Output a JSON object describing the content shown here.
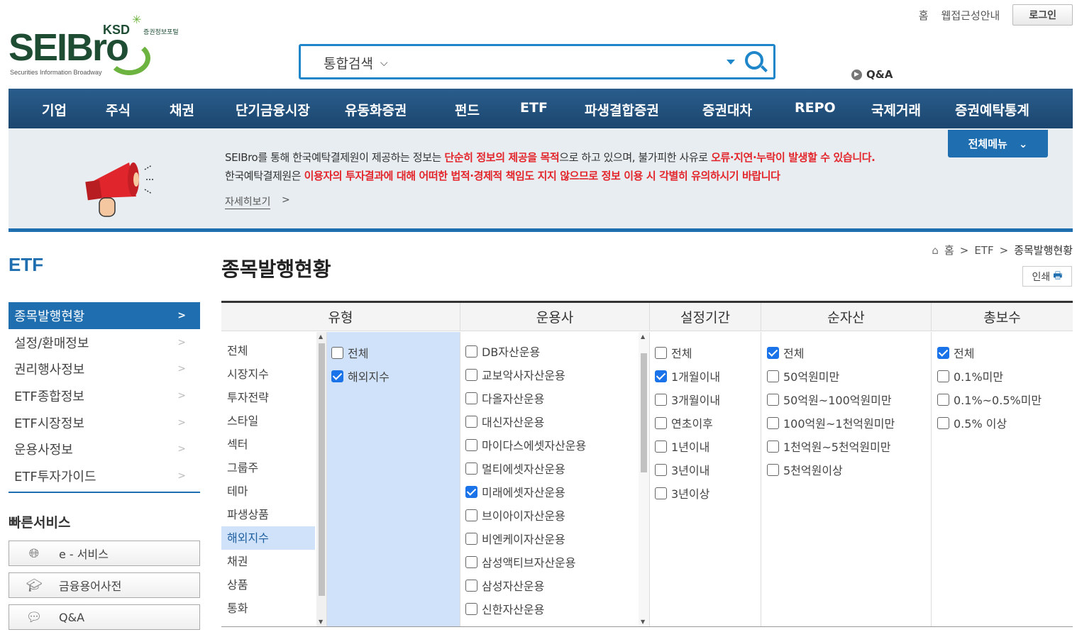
{
  "header": {
    "logo_main": "SEIBro",
    "logo_ksd": "KSD",
    "logo_portal": "증권정보포털",
    "logo_sub": "Securities Information Broadway",
    "links": [
      "홈",
      "웹접근성안내"
    ],
    "login_label": "로그인",
    "search_select": "통합검색",
    "qa_label": "Q&A"
  },
  "nav": {
    "items": [
      "기업",
      "주식",
      "채권",
      "단기금융시장",
      "유동화증권",
      "펀드",
      "ETF",
      "파생결합증권",
      "증권대차",
      "REPO",
      "국제거래",
      "증권예탁통계"
    ]
  },
  "banner": {
    "line1_a": "SEIBro를 통해 한국예탁결제원이 제공하는 정보는 ",
    "line1_b": "단순히 정보의 제공을 목적",
    "line1_c": "으로 하고 있으며, 불가피한 사유로 ",
    "line1_d": "오류·지연·누락이 발생할 수 있습니다.",
    "line2_a": "한국예탁결제원은 ",
    "line2_b": "이용자의 투자결과에 대해 어떠한 법적·경제적 책임도 지지 않으므로 정보 이용 시 각별히 유의하시기 바랍니다",
    "more_label": "자세히보기",
    "more_arrow": ">",
    "allmenu_label": "전체메뉴"
  },
  "sidebar": {
    "title": "ETF",
    "items": [
      {
        "label": "종목발행현황",
        "active": true
      },
      {
        "label": "설정/환매정보",
        "active": false
      },
      {
        "label": "권리행사정보",
        "active": false
      },
      {
        "label": "ETF종합정보",
        "active": false
      },
      {
        "label": "ETF시장정보",
        "active": false
      },
      {
        "label": "운용사정보",
        "active": false
      },
      {
        "label": "ETF투자가이드",
        "active": false
      }
    ],
    "fast_title": "빠른서비스",
    "services": [
      "e - 서비스",
      "금융용어사전",
      "Q&A"
    ]
  },
  "main": {
    "title": "종목발행현황",
    "breadcrumb": [
      "홈",
      "ETF",
      "종목발행현황"
    ],
    "print_label": "인쇄",
    "headers": [
      "유형",
      "운용사",
      "설정기간",
      "순자산",
      "총보수"
    ],
    "type_categories": [
      "전체",
      "시장지수",
      "투자전략",
      "스타일",
      "섹터",
      "그룹주",
      "테마",
      "파생상품",
      "해외지수",
      "채권",
      "상품",
      "통화"
    ],
    "type_selected_index": 8,
    "type_options": [
      {
        "label": "전체",
        "checked": false
      },
      {
        "label": "해외지수",
        "checked": true
      }
    ],
    "managers": [
      {
        "label": "DB자산운용",
        "checked": false
      },
      {
        "label": "교보악사자산운용",
        "checked": false
      },
      {
        "label": "다올자산운용",
        "checked": false
      },
      {
        "label": "대신자산운용",
        "checked": false
      },
      {
        "label": "마이다스에셋자산운용",
        "checked": false
      },
      {
        "label": "멀티에셋자산운용",
        "checked": false
      },
      {
        "label": "미래에셋자산운용",
        "checked": true
      },
      {
        "label": "브이아이자산운용",
        "checked": false
      },
      {
        "label": "비엔케이자산운용",
        "checked": false
      },
      {
        "label": "삼성액티브자산운용",
        "checked": false
      },
      {
        "label": "삼성자산운용",
        "checked": false
      },
      {
        "label": "신한자산운용",
        "checked": false
      }
    ],
    "periods": [
      {
        "label": "전체",
        "checked": false
      },
      {
        "label": "1개월이내",
        "checked": true
      },
      {
        "label": "3개월이내",
        "checked": false
      },
      {
        "label": "연초이후",
        "checked": false
      },
      {
        "label": "1년이내",
        "checked": false
      },
      {
        "label": "3년이내",
        "checked": false
      },
      {
        "label": "3년이상",
        "checked": false
      }
    ],
    "net_assets": [
      {
        "label": "전체",
        "checked": true
      },
      {
        "label": "50억원미만",
        "checked": false
      },
      {
        "label": "50억원~100억원미만",
        "checked": false
      },
      {
        "label": "100억원~1천억원미만",
        "checked": false
      },
      {
        "label": "1천억원~5천억원미만",
        "checked": false
      },
      {
        "label": "5천억원이상",
        "checked": false
      }
    ],
    "fees": [
      {
        "label": "전체",
        "checked": true
      },
      {
        "label": "0.1%미만",
        "checked": false
      },
      {
        "label": "0.1%~0.5%미만",
        "checked": false
      },
      {
        "label": "0.5% 이상",
        "checked": false
      }
    ]
  }
}
